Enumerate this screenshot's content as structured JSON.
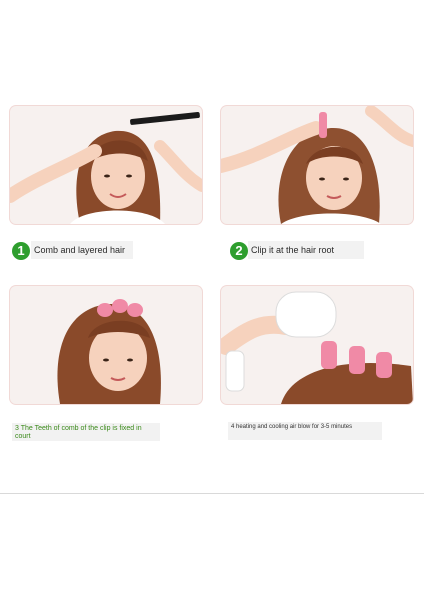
{
  "steps": [
    {
      "number": "1",
      "caption": "Comb and layered hair"
    },
    {
      "number": "2",
      "caption": "Clip it at the hair root"
    },
    {
      "number": "3",
      "caption": "3 The Teeth of comb of the clip is fixed in court"
    },
    {
      "number": "4",
      "caption": "4 heating and cooling air blow for 3-5 minutes"
    }
  ],
  "colors": {
    "badge": "#2e9e2e",
    "clip": "#f08aa6",
    "hair": "#8a4a2a",
    "skin": "#f6d2bd"
  }
}
